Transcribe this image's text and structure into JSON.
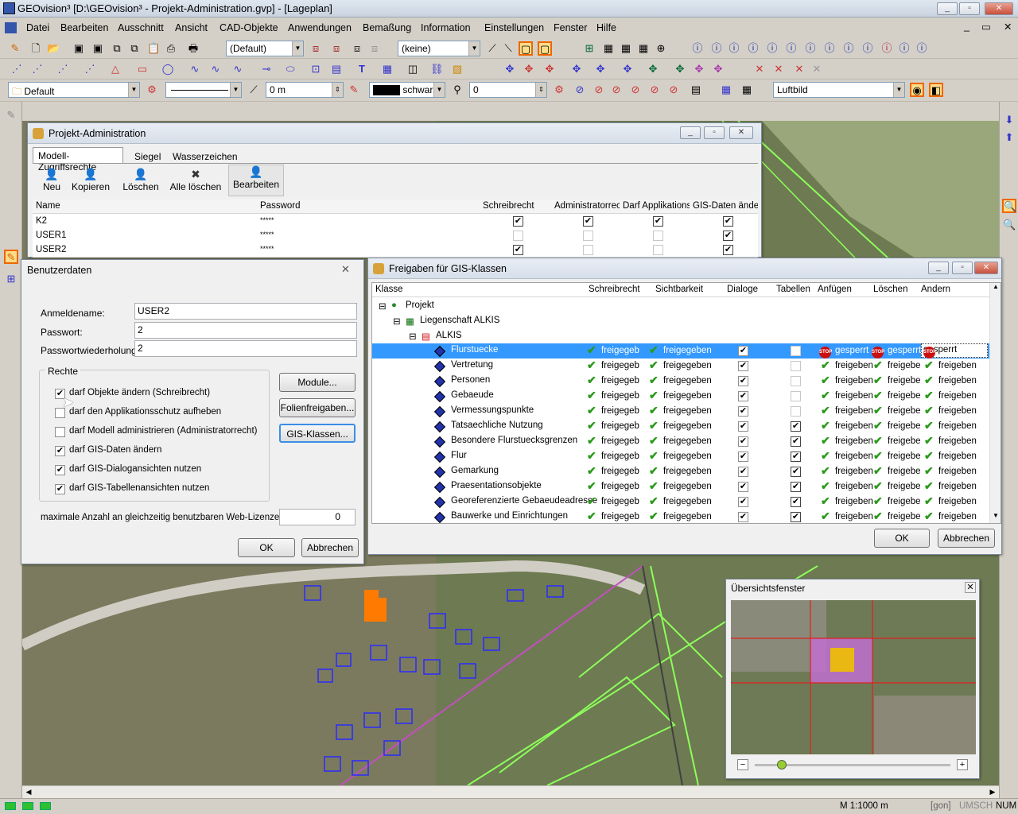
{
  "app": {
    "title": "GEOvision³  [D:\\GEOvision³ - Projekt-Administration.gvp] - [Lageplan]"
  },
  "menu": [
    "Datei",
    "Bearbeiten",
    "Ausschnitt",
    "Ansicht",
    "CAD-Objekte",
    "Anwendungen",
    "Bemaßung",
    "Information",
    "Einstellungen",
    "Fenster",
    "Hilfe"
  ],
  "toolbar": {
    "layer_combo": "(Default)",
    "none_combo": "(keine)",
    "style_combo": "Default",
    "width_value": "0 m",
    "color_label": "schwarz",
    "num_value": "0",
    "background_combo": "Luftbild"
  },
  "projadmin": {
    "title": "Projekt-Administration",
    "tabs": [
      "Modell-Zugriffsrechte",
      "Siegel",
      "Wasserzeichen"
    ],
    "actions": [
      "Neu",
      "Kopieren",
      "Löschen",
      "Alle löschen",
      "Bearbeiten"
    ],
    "columns": [
      "Name",
      "Password",
      "Schreibrecht",
      "Administratorrech",
      "Darf Applikations:",
      "GIS-Daten änder"
    ],
    "rows": [
      {
        "name": "K2",
        "password": "*****",
        "w": true,
        "a": true,
        "d": true,
        "g": true
      },
      {
        "name": "USER1",
        "password": "*****",
        "w": false,
        "a": false,
        "d": false,
        "g": true
      },
      {
        "name": "USER2",
        "password": "*****",
        "w": true,
        "a": false,
        "d": false,
        "g": true
      }
    ]
  },
  "userdata": {
    "title": "Benutzerdaten",
    "login_label": "Anmeldename:",
    "login_value": "USER2",
    "pw_label": "Passwort:",
    "pw_value": "2",
    "pw2_label": "Passwortwiederholung:",
    "pw2_value": "2",
    "rights_label": "Rechte",
    "rights": [
      {
        "label": "darf Objekte ändern (Schreibrecht)",
        "checked": true
      },
      {
        "label": "darf den Applikationsschutz aufheben",
        "checked": false
      },
      {
        "label": "darf Modell administrieren (Administratorrecht)",
        "checked": false
      },
      {
        "label": "darf GIS-Daten ändern",
        "checked": true
      },
      {
        "label": "darf GIS-Dialogansichten nutzen",
        "checked": true
      },
      {
        "label": "darf GIS-Tabellenansichten nutzen",
        "checked": true
      }
    ],
    "btn_module": "Module...",
    "btn_folien": "Folienfreigaben...",
    "btn_gis": "GIS-Klassen...",
    "weblic_label": "maximale Anzahl an gleichzeitig benutzbaren Web-Lizenzen:",
    "weblic_value": "0",
    "ok": "OK",
    "cancel": "Abbrechen"
  },
  "gis": {
    "title": "Freigaben für GIS-Klassen",
    "columns": [
      "Klasse",
      "Schreibrecht",
      "Sichtbarkeit",
      "Dialoge",
      "Tabellen",
      "Anfügen",
      "Löschen",
      "Ändern"
    ],
    "tree": [
      {
        "label": "Projekt"
      },
      {
        "label": "Liegenschaft ALKIS"
      },
      {
        "label": "ALKIS"
      }
    ],
    "rows": [
      {
        "name": "Flurstuecke",
        "dlg": true,
        "tab": false,
        "locked": true
      },
      {
        "name": "Vertretung",
        "dlg": true,
        "tab": false
      },
      {
        "name": "Personen",
        "dlg": true,
        "tab": false
      },
      {
        "name": "Gebaeude",
        "dlg": true,
        "tab": false
      },
      {
        "name": "Vermessungspunkte",
        "dlg": true,
        "tab": false
      },
      {
        "name": "Tatsaechliche Nutzung",
        "dlg": true,
        "tab": true
      },
      {
        "name": "Besondere Flurstuecksgrenzen",
        "dlg": true,
        "tab": true
      },
      {
        "name": "Flur",
        "dlg": true,
        "tab": true
      },
      {
        "name": "Gemarkung",
        "dlg": true,
        "tab": true
      },
      {
        "name": "Praesentationsobjekte",
        "dlg": true,
        "tab": true
      },
      {
        "name": "Georeferenzierte Gebaeudeadresse",
        "dlg": true,
        "tab": true
      },
      {
        "name": "Bauwerke und Einrichtungen",
        "dlg": true,
        "tab": true
      }
    ],
    "freig_w": "freigegeben",
    "freig_s": "freigegeben",
    "freig_short": "freigegeb",
    "freig_add": "freigeben",
    "freig_del": "freigebe",
    "freig_mod": "freigeben",
    "locked": "gesperrt",
    "ok": "OK",
    "cancel": "Abbrechen"
  },
  "overview": {
    "title": "Übersichtsfenster"
  },
  "status": {
    "scale": "M 1:1000  m",
    "gon": "[gon]",
    "umsch": "UMSCH",
    "num": "NUM"
  },
  "colors": {
    "selection": "#3399ff",
    "accent_green": "#8cff5a"
  }
}
